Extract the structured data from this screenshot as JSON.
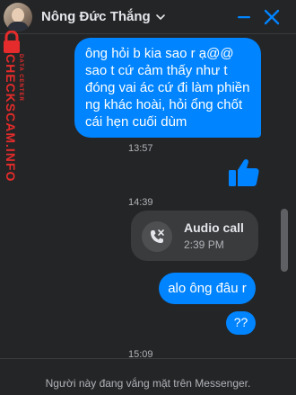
{
  "header": {
    "contact_name": "Nông Đức Thắng"
  },
  "watermark": {
    "brand": "CHECKSCAM.INFO",
    "sub": "DATA CENTER"
  },
  "messages": {
    "m1": "ông hỏi b kia sao r ạ@@ sao t cứ cảm thấy như t đóng vai ác cứ đi làm phiền ng khác hoài, hỏi ổng chốt cái hẹn cuối dùm",
    "time1": "13:57",
    "time2": "14:39",
    "call_title": "Audio call",
    "call_time": "2:39 PM",
    "m2": "alo ông đâu r",
    "m3": "??",
    "time3": "15:09"
  },
  "footer": {
    "status": "Người này đang vắng mặt trên Messenger."
  },
  "colors": {
    "accent": "#0084ff",
    "background": "#242526",
    "watermark": "#e52b2b"
  }
}
